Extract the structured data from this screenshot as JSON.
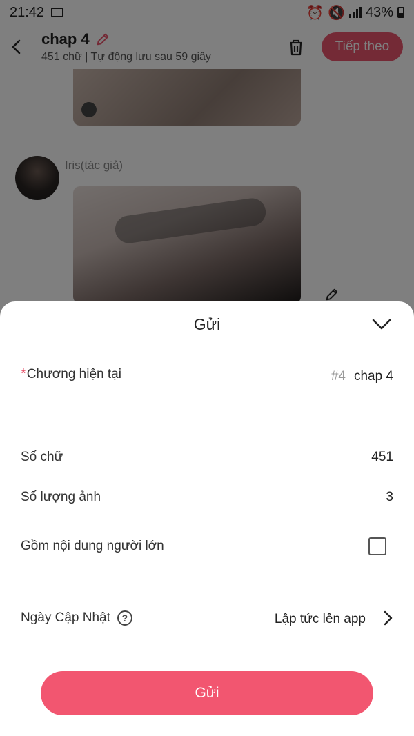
{
  "status_bar": {
    "time": "21:42",
    "battery": "43%"
  },
  "header": {
    "title": "chap 4",
    "subtitle": "451 chữ | Tự động lưu sau 59 giây",
    "next_label": "Tiếp theo",
    "icons": [
      "back-icon",
      "pencil-icon",
      "trash-icon"
    ]
  },
  "content": {
    "author_name": "Iris(tác giả)"
  },
  "sheet": {
    "title": "Gửi",
    "current_chapter": {
      "required_mark": "*",
      "label": "Chương hiện tại",
      "number": "#4",
      "value": "chap 4"
    },
    "word_count": {
      "label": "Số chữ",
      "value": "451"
    },
    "image_count": {
      "label": "Số lượng ảnh",
      "value": "3"
    },
    "adult_content": {
      "label": "Gồm nội dung người lớn",
      "checked": false
    },
    "update_date": {
      "label": "Ngày Cập Nhật",
      "help": "?",
      "value": "Lập tức lên app"
    },
    "submit_label": "Gửi"
  },
  "colors": {
    "accent": "#f25670",
    "overlay": "rgba(0,0,0,0.5)"
  }
}
